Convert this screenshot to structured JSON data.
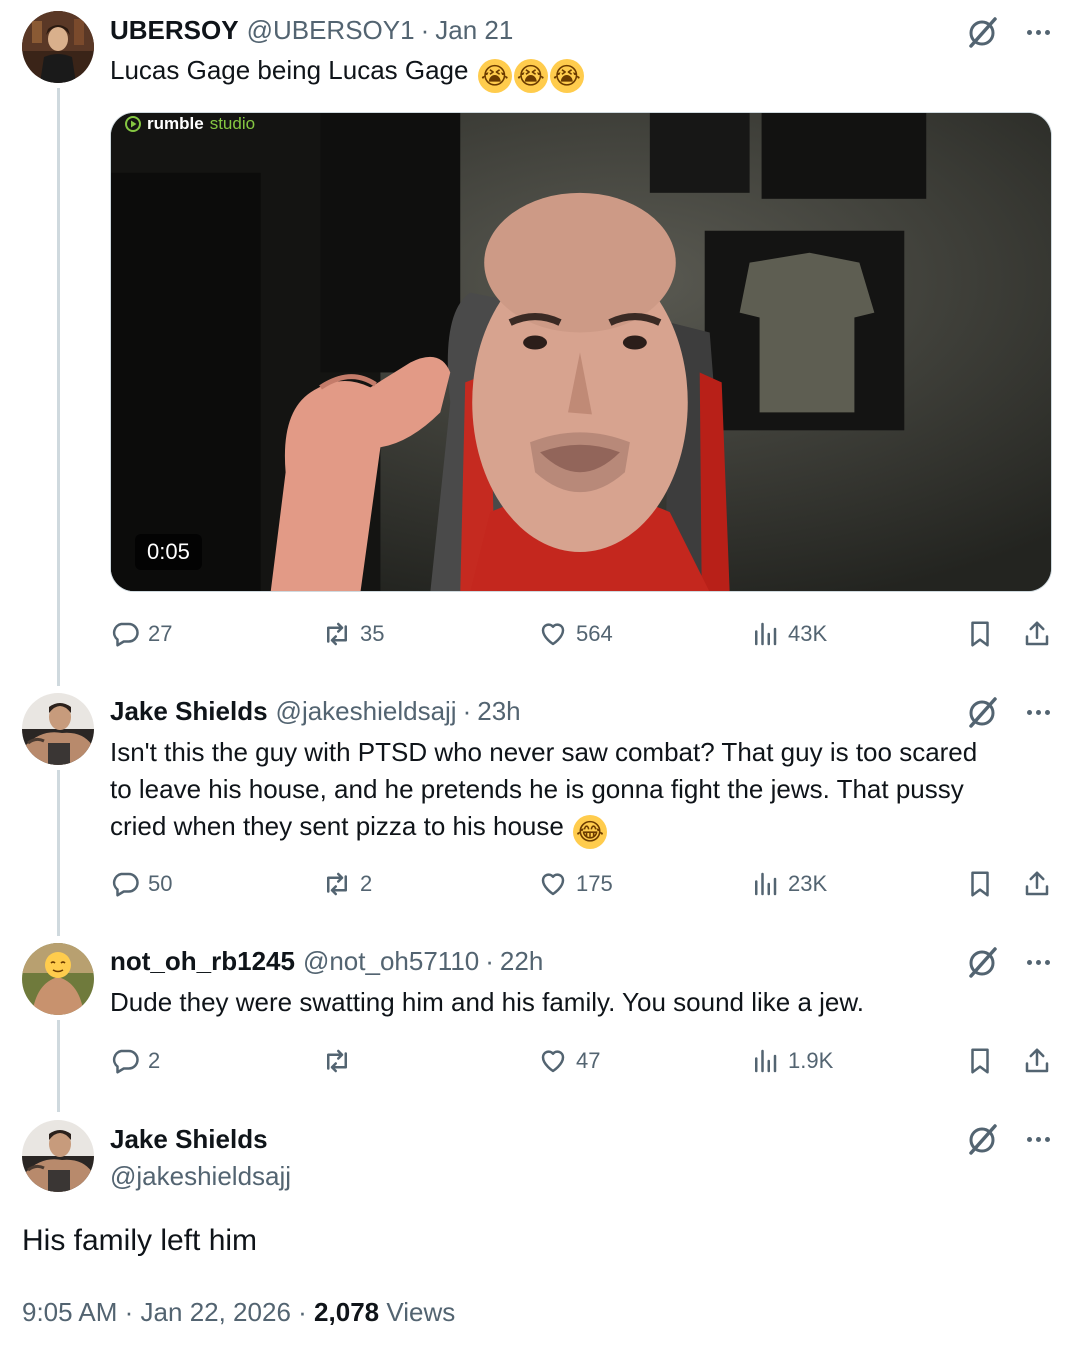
{
  "tweets": [
    {
      "name": "UBERSOY",
      "handle": "@UBERSOY1",
      "separator": "·",
      "time": "Jan 21",
      "text": "Lucas Gage being Lucas Gage",
      "emojis": [
        "😭",
        "😭",
        "😭"
      ],
      "media": {
        "watermark_brand": "rumble",
        "watermark_sub": "studio",
        "duration": "0:05"
      },
      "stats": {
        "replies": "27",
        "reposts": "35",
        "likes": "564",
        "views": "43K"
      }
    },
    {
      "name": "Jake Shields",
      "handle": "@jakeshieldsajj",
      "separator": "·",
      "time": "23h",
      "text_lines": [
        "Isn't this the guy with PTSD who never saw combat?   That guy is too scared",
        "to leave his house, and he pretends he is gonna fight the jews.  That pussy",
        "cried when they sent pizza to his house"
      ],
      "emoji": "😂",
      "stats": {
        "replies": "50",
        "reposts": "2",
        "likes": "175",
        "views": "23K"
      }
    },
    {
      "name": "not_oh_rb1245",
      "handle": "@not_oh57110",
      "separator": "·",
      "time": "22h",
      "text": "Dude they were swatting him and his family. You sound like a jew.",
      "stats": {
        "replies": "2",
        "reposts": "",
        "likes": "47",
        "views": "1.9K"
      }
    }
  ],
  "main_tweet": {
    "name": "Jake Shields",
    "handle": "@jakeshieldsajj",
    "text": "His family left him",
    "time": "9:05 AM",
    "sep1": "·",
    "date": "Jan 22, 2026",
    "sep2": "·",
    "views_count": "2,078",
    "views_label": "Views"
  },
  "icons": {
    "reply": "reply-bubble-icon",
    "repost": "repost-arrows-icon",
    "like": "heart-icon",
    "views": "bar-chart-icon",
    "bookmark": "bookmark-icon",
    "share": "share-upload-icon",
    "grok": "grok-slash-icon",
    "more": "more-dots-icon"
  },
  "colors": {
    "text": "#0f1419",
    "muted": "#536471",
    "line": "#cfd9de",
    "rumble_green": "#85c742"
  }
}
